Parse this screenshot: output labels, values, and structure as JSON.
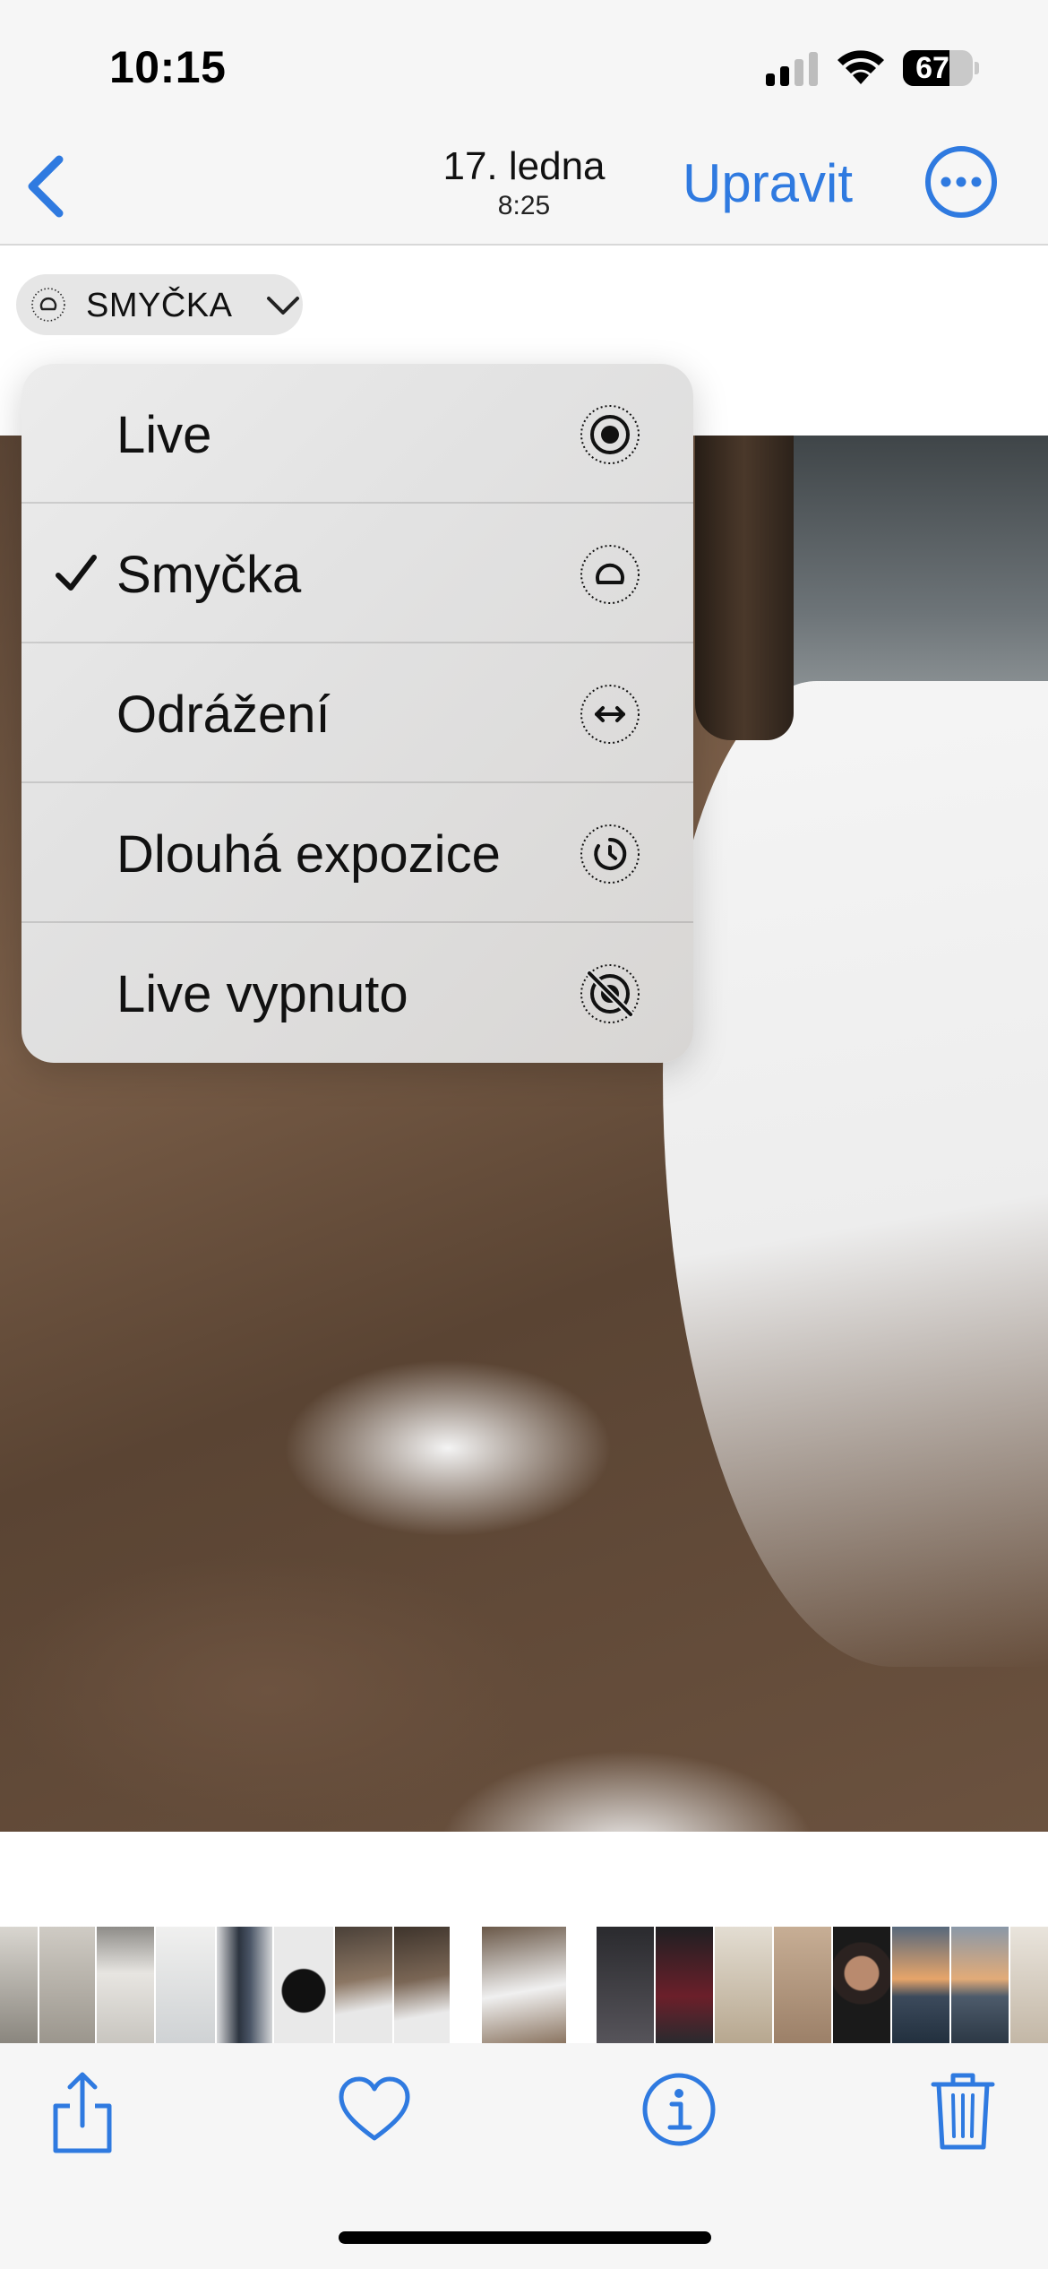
{
  "status_bar": {
    "time": "10:15",
    "battery": "67",
    "battery_level_percent": 67,
    "icons": [
      "cellular-signal-icon",
      "wifi-icon",
      "battery-icon"
    ]
  },
  "nav": {
    "back_icon": "chevron-left-icon",
    "date": "17. ledna",
    "time": "8:25",
    "edit_label": "Upravit",
    "more_icon": "ellipsis-circle-icon"
  },
  "live_chip": {
    "icon": "loop-icon",
    "label": "SMYČKA",
    "chevron_icon": "chevron-down-icon"
  },
  "menu": {
    "items": [
      {
        "label": "Live",
        "icon": "live-photo-icon",
        "checked": false
      },
      {
        "label": "Smyčka",
        "icon": "loop-icon",
        "checked": true
      },
      {
        "label": "Odrážení",
        "icon": "bounce-icon",
        "checked": false
      },
      {
        "label": "Dlouhá expozice",
        "icon": "long-exposure-icon",
        "checked": false
      },
      {
        "label": "Live vypnuto",
        "icon": "live-off-icon",
        "checked": false
      }
    ]
  },
  "toolbar": {
    "share_icon": "share-icon",
    "favorite_icon": "heart-icon",
    "info_icon": "info-circle-icon",
    "delete_icon": "trash-icon"
  },
  "colors": {
    "accent": "#2f7ae0",
    "bar_background": "#f6f6f6",
    "menu_text": "#111111"
  }
}
